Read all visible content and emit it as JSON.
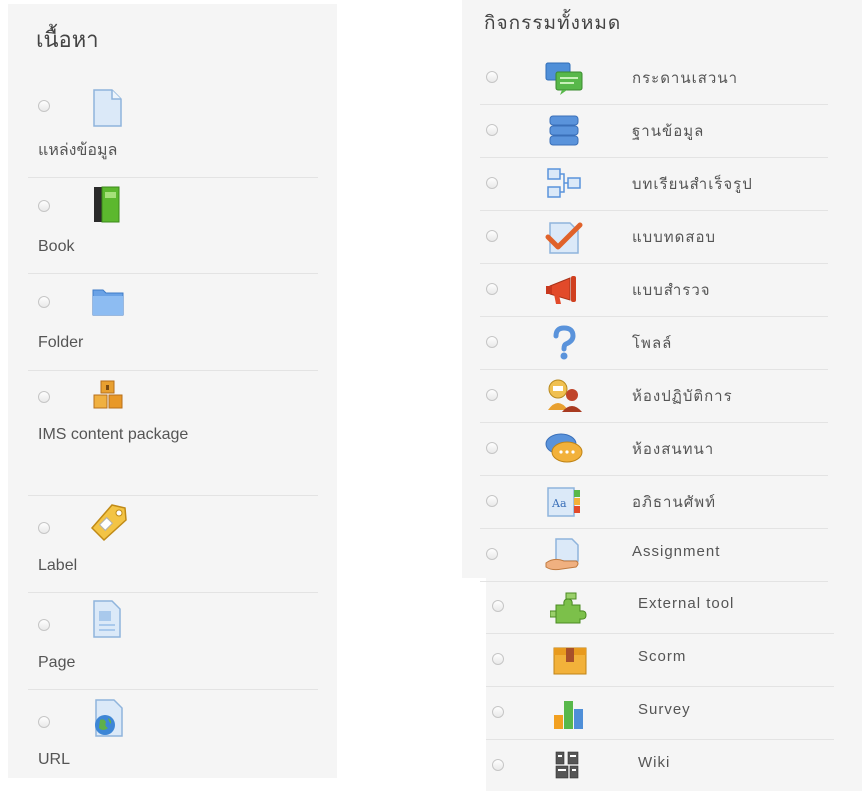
{
  "resources": {
    "title": "เนื้อหา",
    "items": [
      {
        "name": "resource-file",
        "icon": "file-icon",
        "label": "แหล่งข้อมูล"
      },
      {
        "name": "resource-book",
        "icon": "book-icon",
        "label": "Book"
      },
      {
        "name": "resource-folder",
        "icon": "folder-icon",
        "label": "Folder"
      },
      {
        "name": "resource-ims",
        "icon": "package-icon",
        "label": "IMS content package"
      },
      {
        "name": "resource-label",
        "icon": "tag-icon",
        "label": "Label"
      },
      {
        "name": "resource-page",
        "icon": "page-icon",
        "label": "Page"
      },
      {
        "name": "resource-url",
        "icon": "globe-page-icon",
        "label": "URL"
      }
    ]
  },
  "activities": {
    "title": "กิจกรรมทั้งหมด",
    "items": [
      {
        "name": "activity-forum",
        "icon": "forum-icon",
        "label": "กระดานเสวนา"
      },
      {
        "name": "activity-database",
        "icon": "database-icon",
        "label": "ฐานข้อมูล"
      },
      {
        "name": "activity-lesson",
        "icon": "lesson-icon",
        "label": "บทเรียนสำเร็จรูป"
      },
      {
        "name": "activity-quiz",
        "icon": "quiz-icon",
        "label": "แบบทดสอบ"
      },
      {
        "name": "activity-feedback",
        "icon": "megaphone-icon",
        "label": "แบบสำรวจ"
      },
      {
        "name": "activity-choice",
        "icon": "question-icon",
        "label": "โพลล์"
      },
      {
        "name": "activity-workshop",
        "icon": "workshop-icon",
        "label": "ห้องปฏิบัติการ"
      },
      {
        "name": "activity-chat",
        "icon": "chat-icon",
        "label": "ห้องสนทนา"
      },
      {
        "name": "activity-glossary",
        "icon": "glossary-icon",
        "label": "อภิธานศัพท์"
      },
      {
        "name": "activity-assignment",
        "icon": "assignment-icon",
        "label": "Assignment"
      },
      {
        "name": "activity-external-tool",
        "icon": "puzzle-icon",
        "label": "External tool"
      },
      {
        "name": "activity-scorm",
        "icon": "scorm-package-icon",
        "label": "Scorm"
      },
      {
        "name": "activity-survey",
        "icon": "bar-chart-icon",
        "label": "Survey"
      },
      {
        "name": "activity-wiki",
        "icon": "wiki-icon",
        "label": "Wiki"
      }
    ]
  }
}
